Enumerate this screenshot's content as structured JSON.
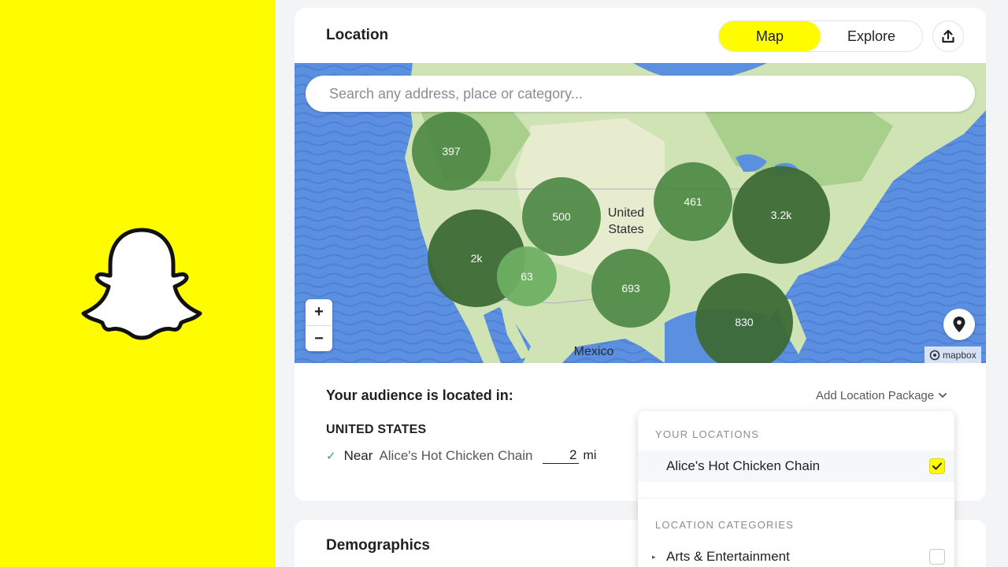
{
  "colors": {
    "brand_yellow": "#fffc00",
    "ocean": "#5b8fe0",
    "land": "#cfe3b5",
    "cluster_dark": "#3d6b36",
    "cluster_mid": "#4f8a47",
    "cluster_light": "#6db063"
  },
  "brand": {
    "logo_icon": "snapchat-ghost-icon"
  },
  "location": {
    "title": "Location",
    "view_tabs": [
      {
        "label": "Map",
        "active": true
      },
      {
        "label": "Explore",
        "active": false
      }
    ],
    "export_icon": "upload-icon"
  },
  "map": {
    "search_placeholder": "Search any address, place or category...",
    "clusters": [
      {
        "label": "397"
      },
      {
        "label": "500"
      },
      {
        "label": "2k"
      },
      {
        "label": "63"
      },
      {
        "label": "693"
      },
      {
        "label": "461"
      },
      {
        "label": "3.2k"
      },
      {
        "label": "830"
      }
    ],
    "region_labels": {
      "us": "United\nStates",
      "mexico": "Mexico"
    },
    "zoom_in": "+",
    "zoom_out": "−",
    "attribution": "mapbox"
  },
  "audience": {
    "title": "Your audience is located in:",
    "add_package": "Add Location Package",
    "country": "UNITED STATES",
    "near_label": "Near",
    "place": "Alice's Hot Chicken Chain",
    "radius": "2",
    "unit": "mi"
  },
  "dropdown": {
    "your_locations_heading": "YOUR LOCATIONS",
    "your_locations": [
      {
        "label": "Alice's Hot Chicken Chain",
        "checked": true
      }
    ],
    "categories_heading": "LOCATION CATEGORIES",
    "categories": [
      {
        "label": "Arts & Entertainment",
        "checked": false
      }
    ]
  },
  "demographics": {
    "title": "Demographics"
  }
}
